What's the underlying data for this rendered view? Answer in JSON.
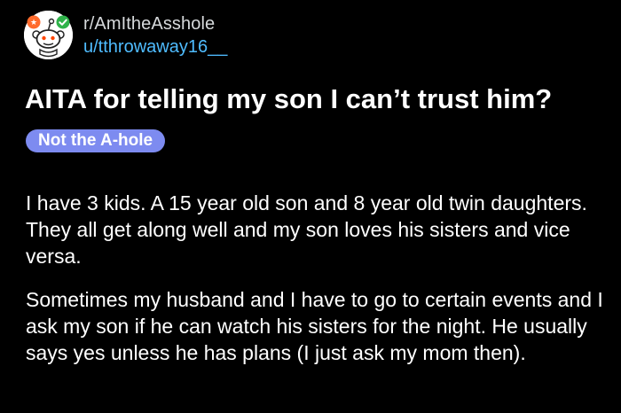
{
  "post": {
    "subreddit": "r/AmItheAsshole",
    "username": "u/tthrowaway16__",
    "avatar_icon": "snoo-avatar-icon",
    "title": "AITA for telling my son I can’t trust him?",
    "flair": {
      "label": "Not the A-hole",
      "color": "#7d8bf0"
    },
    "body_paragraphs": [
      "I have 3 kids. A 15 year old son and 8 year old twin daughters. They all get along well and my son loves his sisters and vice versa.",
      "Sometimes my husband and I have to go to certain events and I ask my son if he can watch his sisters for the night. He usually says yes unless he has plans (I just ask my mom then)."
    ]
  },
  "colors": {
    "background": "#000000",
    "username": "#4fbcff",
    "subreddit": "#d7dadc",
    "text": "#ffffff"
  }
}
